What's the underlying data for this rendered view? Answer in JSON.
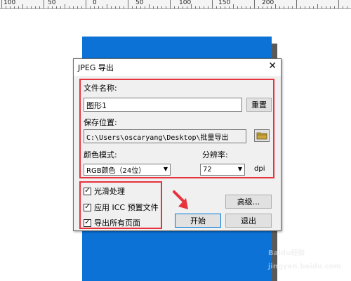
{
  "ruler": {
    "labels": [
      "100",
      "50",
      "0",
      "50",
      "100",
      "150",
      "200"
    ]
  },
  "dialog": {
    "title": "JPEG 导出",
    "close": "✕",
    "filename_label": "文件名称:",
    "filename_value": "图形1",
    "reset_label": "重置",
    "save_label": "保存位置:",
    "save_path": "C:\\Users\\oscaryang\\Desktop\\批量导出",
    "color_mode_label": "颜色模式:",
    "color_mode_value": "RGB颜色（24位）",
    "resolution_label": "分辨率:",
    "resolution_value": "72",
    "dpi_label": "dpi",
    "checkboxes": [
      {
        "label": "光滑处理",
        "checked": true
      },
      {
        "label": "应用 ICC 预置文件",
        "checked": true
      },
      {
        "label": "导出所有页面",
        "checked": true
      }
    ],
    "advanced_label": "高级...",
    "start_label": "开始",
    "exit_label": "退出"
  },
  "watermark": "Baidu经验 jingyan.baidu.com",
  "colors": {
    "highlight": "#e8333d",
    "shape": "#0c72d6"
  }
}
